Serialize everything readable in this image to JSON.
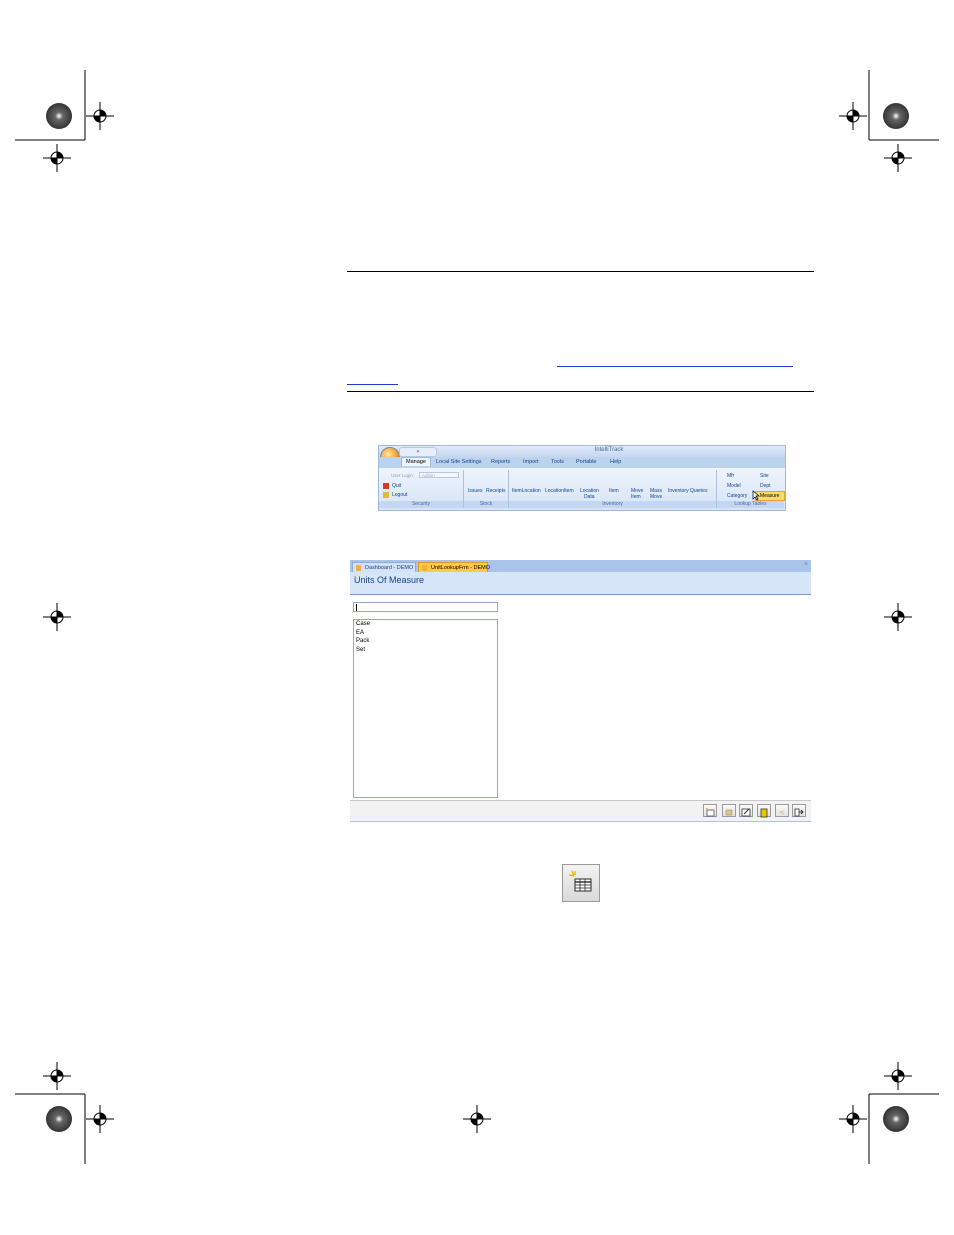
{
  "ribbon": {
    "app_title": "IntelliTrack",
    "qat_label": "▾",
    "tabs": [
      "Manage",
      "Local Site Settings",
      "Reports",
      "Import",
      "Tools",
      "Portable",
      "Help"
    ],
    "user_login_label": "User Login:",
    "user_login_value": "Admin",
    "security": {
      "quit": "Quit",
      "logout": "Logout",
      "group": "Security"
    },
    "stock": {
      "issues": "Issues",
      "receipts": "Receipts",
      "group": "Stock"
    },
    "inventory": {
      "item_location": "ItemLocation",
      "location_item": "LocationItem",
      "location_data_1": "Location",
      "location_data_2": "Data",
      "item": "Item",
      "move_item_1": "Move",
      "move_item_2": "Item",
      "mass_move_1": "Mass",
      "mass_move_2": "Move",
      "inventory_queries": "Inventory Queries",
      "group": "Inventory"
    },
    "lookup": {
      "mfr": "Mfr",
      "site": "Site",
      "model": "Model",
      "dept": "Dept",
      "category": "Category",
      "measure": "Measure",
      "group": "Lookup Tables"
    }
  },
  "form": {
    "tab_inactive": "Dashboard - DEMO",
    "tab_active": "UnitLookupFrm - DEMO",
    "close": "×",
    "title": "Units Of Measure",
    "search_value": "",
    "units": [
      "Case",
      "EA",
      "Pack",
      "Set"
    ]
  },
  "icons": [
    "new-record-icon",
    "save-icon",
    "edit-icon",
    "delete-icon",
    "undo-icon",
    "exit-icon"
  ]
}
